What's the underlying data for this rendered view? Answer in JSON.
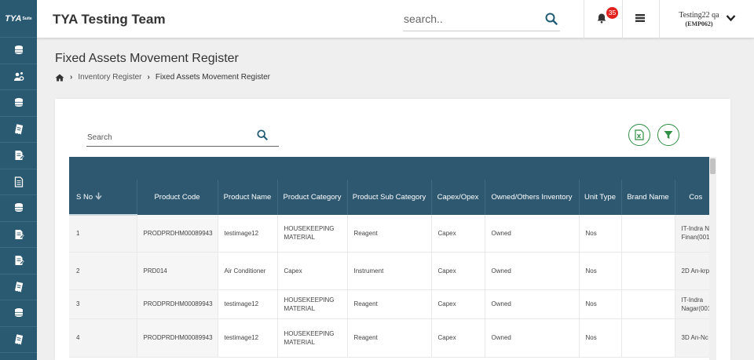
{
  "sidebar": {
    "logo": "TYA",
    "logo_suffix": "Suite",
    "items": [
      "database-icon",
      "users-cog-icon",
      "database-icon",
      "receipt-icon",
      "file-edit-icon",
      "file-text-icon",
      "database-icon",
      "file-edit-icon",
      "file-edit-icon",
      "receipt-icon",
      "database-icon",
      "receipt-icon"
    ]
  },
  "header": {
    "title": "TYA Testing Team",
    "search_placeholder": "search..",
    "notification_count": "35",
    "user_name": "Testing22 qa",
    "user_code": "(EMP062)"
  },
  "page": {
    "title": "Fixed Assets Movement Register",
    "breadcrumb": [
      "Inventory Register",
      "Fixed Assets Movement Register"
    ]
  },
  "table": {
    "search_placeholder": "Search",
    "columns": [
      "S No",
      "Product Code",
      "Product Name",
      "Product Category",
      "Product Sub Category",
      "Capex/Opex",
      "Owned/Others Inventory",
      "Unit Type",
      "Brand Name",
      "Cos"
    ],
    "rows": [
      {
        "sno": "1",
        "code": "PRODPRDHM00089943",
        "name": "testimage12",
        "category": "HOUSEKEEPING MATERIAL",
        "sub": "Reagent",
        "capex": "Capex",
        "owned": "Owned",
        "unit": "Nos",
        "brand": "",
        "cost": "IT-Indra N Finan(001"
      },
      {
        "sno": "2",
        "code": "PRD014",
        "name": "Air Conditioner",
        "category": "Capex",
        "sub": "Instrument",
        "capex": "Capex",
        "owned": "Owned",
        "unit": "Nos",
        "brand": "",
        "cost": "2D An-krp"
      },
      {
        "sno": "3",
        "code": "PRODPRDHM00089943",
        "name": "testimage12",
        "category": "HOUSEKEEPING MATERIAL",
        "sub": "Reagent",
        "capex": "Capex",
        "owned": "Owned",
        "unit": "Nos",
        "brand": "",
        "cost": "IT-Indra Nagar(001"
      },
      {
        "sno": "4",
        "code": "PRODPRDHM00089943",
        "name": "testimage12",
        "category": "HOUSEKEEPING MATERIAL",
        "sub": "Reagent",
        "capex": "Capex",
        "owned": "Owned",
        "unit": "Nos",
        "brand": "",
        "cost": "3D An-Nc p"
      }
    ]
  },
  "colors": {
    "sidebar": "#2a5972",
    "table_header": "#2d5870",
    "accent": "#1f5a73",
    "badge": "#e2211c",
    "action_green": "#2f8f45"
  }
}
